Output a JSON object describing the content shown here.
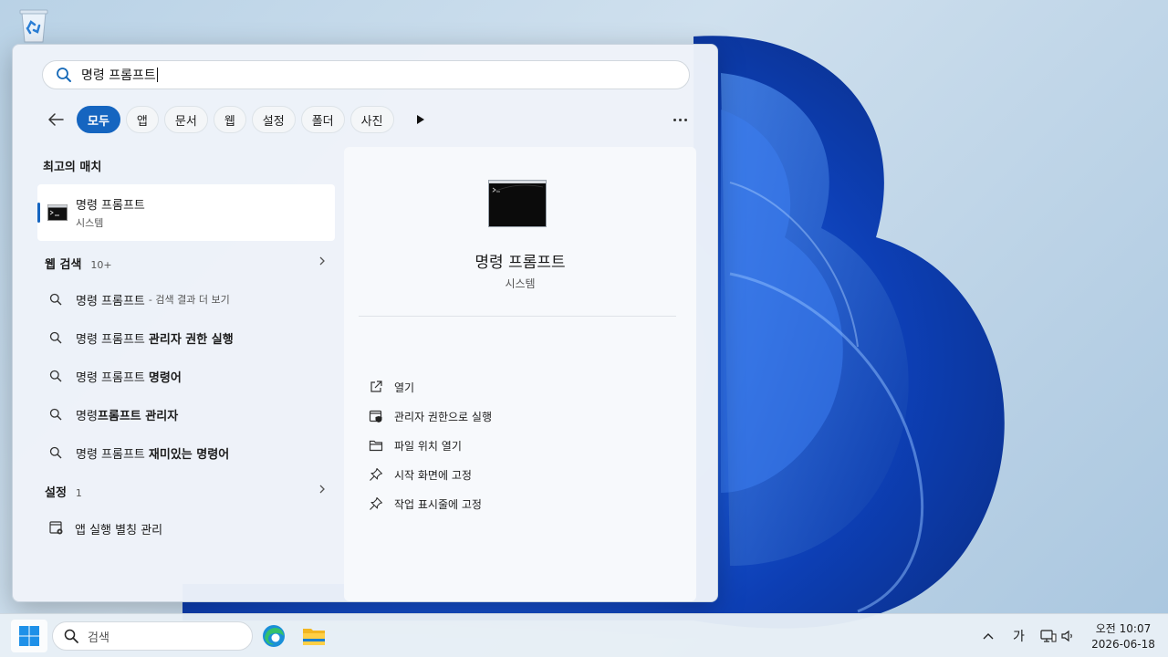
{
  "desktop": {
    "recycle_bin_icon": "recycle-bin-icon"
  },
  "search": {
    "query": "명령 프롬프트",
    "icon": "search-icon"
  },
  "filters": {
    "items": [
      "모두",
      "앱",
      "문서",
      "웹",
      "설정",
      "폴더",
      "사진"
    ],
    "active": "모두"
  },
  "best_match": {
    "heading": "최고의 매치",
    "title": "명령 프롬프트",
    "subtitle": "시스템"
  },
  "web_search": {
    "heading": "웹 검색",
    "count": "10+",
    "items": [
      {
        "plain": "명령 프롬프트",
        "bold": "",
        "sub": "- 검색 결과 더 보기"
      },
      {
        "plain": "명령 프롬프트",
        "bold": "관리자 권한 실행",
        "sub": ""
      },
      {
        "plain": "명령 프롬프트",
        "bold": "명령어",
        "sub": ""
      },
      {
        "plain": "명령",
        "bold": "프롬프트 관리자",
        "sub": ""
      },
      {
        "plain": "명령 프롬프트",
        "bold": "재미있는 명령어",
        "sub": ""
      }
    ]
  },
  "settings": {
    "heading": "설정",
    "count": "1",
    "items": [
      {
        "label": "앱 실행 별칭 관리"
      }
    ]
  },
  "detail": {
    "title": "명령 프롬프트",
    "subtitle": "시스템",
    "actions": [
      {
        "label": "열기",
        "icon": "open-external-icon"
      },
      {
        "label": "관리자 권한으로 실행",
        "icon": "shield-admin-icon"
      },
      {
        "label": "파일 위치 열기",
        "icon": "folder-icon"
      },
      {
        "label": "시작 화면에 고정",
        "icon": "pin-icon"
      },
      {
        "label": "작업 표시줄에 고정",
        "icon": "pin-icon"
      }
    ]
  },
  "taskbar": {
    "search_placeholder": "검색",
    "ime": "가",
    "time": "오전 10:07",
    "date": "2026-06-18"
  },
  "colors": {
    "accent": "#1565c0"
  }
}
